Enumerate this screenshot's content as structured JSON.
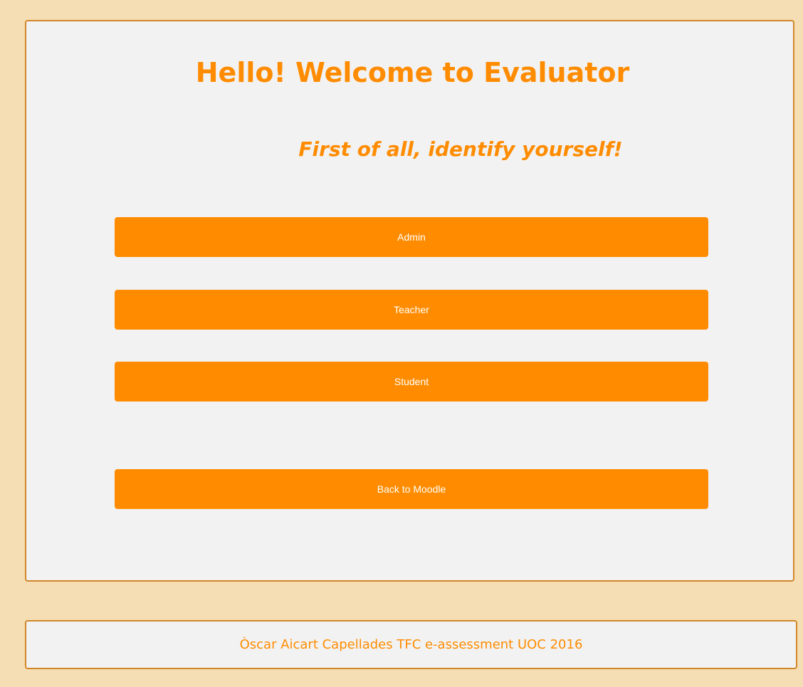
{
  "main": {
    "title": "Hello! Welcome to Evaluator",
    "subtitle": "First of all, identify yourself!",
    "buttons": {
      "admin": "Admin",
      "teacher": "Teacher",
      "student": "Student",
      "back_to_moodle": "Back to Moodle"
    }
  },
  "footer": {
    "text": "Òscar Aicart Capellades TFC e-assessment UOC 2016"
  },
  "colors": {
    "accent": "#ff8c00",
    "page_background": "#f5deb3",
    "panel_background": "#f2f2f2",
    "border": "#d2862a",
    "button_text": "#ffffff"
  }
}
